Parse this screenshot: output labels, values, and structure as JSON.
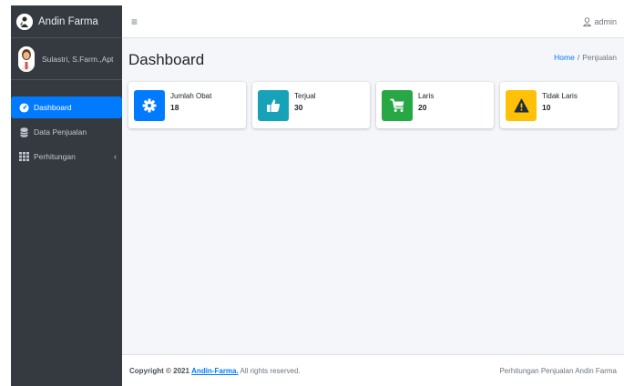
{
  "brand": {
    "name": "Andin Farma"
  },
  "user": {
    "name": "Sulastri, S.Farm.,Apt"
  },
  "nav": {
    "items": [
      {
        "label": "Dashboard",
        "icon": "tachometer-icon",
        "active": true
      },
      {
        "label": "Data Penjualan",
        "icon": "database-icon",
        "active": false
      },
      {
        "label": "Perhitungan",
        "icon": "table-icon",
        "active": false,
        "chevron": "‹"
      }
    ]
  },
  "topbar": {
    "menu_icon": "≡",
    "account_label": "admin"
  },
  "page": {
    "title": "Dashboard",
    "breadcrumb": {
      "home": "Home",
      "separator": "/",
      "current": "Penjualan"
    }
  },
  "cards": [
    {
      "label": "Jumlah Obat",
      "value": "18",
      "icon": "gear-icon",
      "color": "#007bff"
    },
    {
      "label": "Terjual",
      "value": "30",
      "icon": "thumbs-up-icon",
      "color": "#17a2b8"
    },
    {
      "label": "Laris",
      "value": "20",
      "icon": "shopping-cart-icon",
      "color": "#28a745"
    },
    {
      "label": "Tidak Laris",
      "value": "10",
      "icon": "warning-icon",
      "color": "#ffc107"
    }
  ],
  "footer": {
    "copyright": "Copyright © 2021",
    "brand_link": "Andin-Farma.",
    "rights": "All rights reserved.",
    "right_text": "Perhitungan Penjualan Andin Farma"
  },
  "colors": {
    "sidebar_bg": "#343a40",
    "active_nav": "#007bff",
    "content_bg": "#f4f6f9"
  }
}
